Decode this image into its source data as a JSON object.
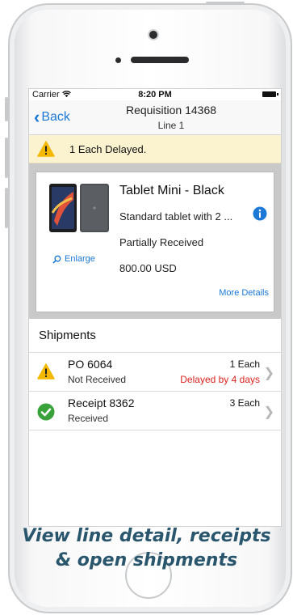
{
  "status_bar": {
    "carrier": "Carrier",
    "time": "8:20 PM"
  },
  "nav": {
    "back_label": "Back",
    "title": "Requisition 14368",
    "subtitle": "Line 1"
  },
  "alert": {
    "text": "1 Each Delayed."
  },
  "product": {
    "name": "Tablet Mini - Black",
    "description": "Standard tablet with 2 ...",
    "status": "Partially Received",
    "price": "800.00 USD",
    "enlarge_label": "Enlarge",
    "more_details_label": "More Details"
  },
  "shipments": {
    "heading": "Shipments",
    "rows": [
      {
        "title": "PO 6064",
        "status": "Not Received",
        "qty": "1 Each",
        "note": "Delayed by 4 days",
        "icon": "warning-icon"
      },
      {
        "title": "Receipt 8362",
        "status": "Received",
        "qty": "3 Each",
        "note": "",
        "icon": "check-circle-icon"
      }
    ]
  },
  "caption": {
    "line1": "View line detail, receipts",
    "line2": "& open shipments"
  },
  "colors": {
    "accent": "#1b78d6",
    "warning": "#f5b800",
    "success": "#3aa23a",
    "delay": "#d9231f",
    "caption": "#29566d"
  }
}
